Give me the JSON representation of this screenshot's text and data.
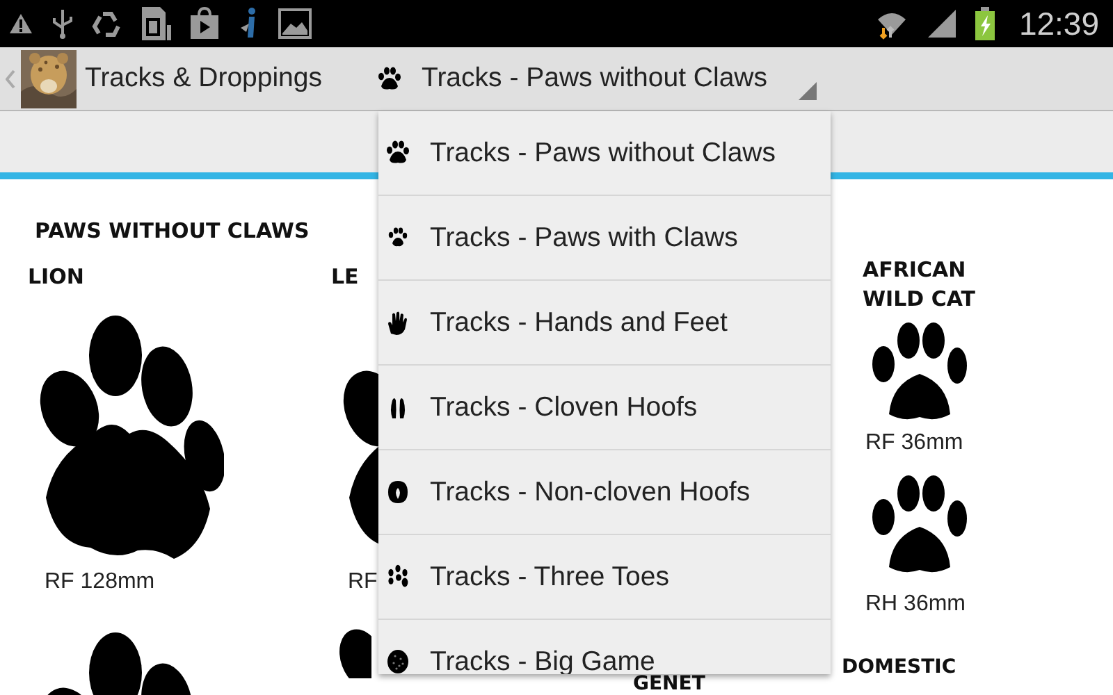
{
  "status_bar": {
    "time": "12:39"
  },
  "action_bar": {
    "title": "Tracks & Droppings",
    "spinner": {
      "kind": "paw",
      "label": "Tracks - Paws without Claws"
    }
  },
  "content": {
    "heading": "PAWS WITHOUT CLAWS",
    "columns": [
      {
        "kind": "large",
        "items": [
          {
            "kind": "title",
            "text": "LION"
          },
          {
            "kind": "paw"
          },
          {
            "kind": "caption",
            "text": "RF 128mm"
          },
          {
            "kind": "paw"
          }
        ]
      },
      {
        "kind": "large",
        "items": [
          {
            "kind": "title",
            "text": "LE"
          },
          {
            "kind": "paw"
          },
          {
            "kind": "caption",
            "text": "RF"
          },
          {
            "kind": "partial-paw"
          }
        ]
      },
      {
        "kind": "bottom",
        "items": [
          {
            "kind": "title",
            "text": "GENET"
          }
        ]
      },
      {
        "kind": "small",
        "items": [
          {
            "kind": "title",
            "text": "AFRICAN WILD CAT"
          },
          {
            "kind": "paw"
          },
          {
            "kind": "caption",
            "text": "RF 36mm"
          },
          {
            "kind": "paw"
          },
          {
            "kind": "caption",
            "text": "RH 36mm"
          },
          {
            "kind": "title",
            "text": "DOMESTIC"
          }
        ]
      }
    ]
  },
  "dropdown": [
    {
      "kind": "paw",
      "label": "Tracks - Paws without Claws"
    },
    {
      "kind": "small-paw",
      "label": "Tracks - Paws with Claws"
    },
    {
      "kind": "hand",
      "label": "Tracks - Hands and Feet"
    },
    {
      "kind": "cloven",
      "label": "Tracks - Cloven Hoofs"
    },
    {
      "kind": "hoof",
      "label": "Tracks - Non-cloven Hoofs"
    },
    {
      "kind": "three-toes",
      "label": "Tracks - Three Toes"
    },
    {
      "kind": "big-game",
      "label": "Tracks - Big Game"
    }
  ]
}
